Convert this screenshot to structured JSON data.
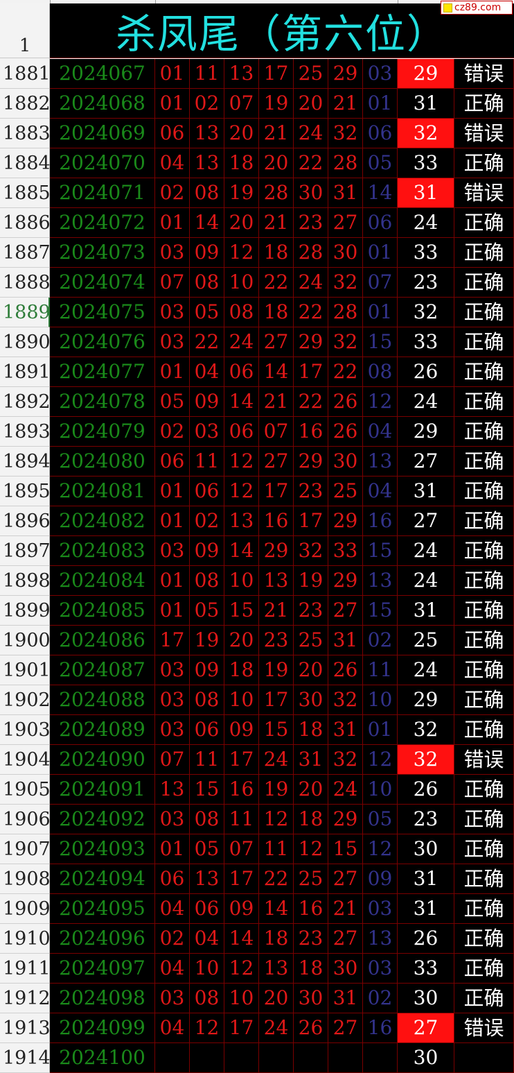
{
  "title": "杀凤尾（第六位）",
  "header_row_number": "1",
  "watermark": "cz89.com",
  "colors": {
    "title": "#22e0e0",
    "period": "#1a8a1a",
    "red_ball": "#e01818",
    "blue_ball": "#33338c",
    "error_fill": "#ff1010",
    "background": "#000000",
    "grid": "#7a0000"
  },
  "active_row": "1889",
  "rows": [
    {
      "rownum": "1881",
      "period": "2024067",
      "balls": [
        "01",
        "11",
        "13",
        "17",
        "25",
        "29"
      ],
      "blue": "03",
      "pred": "29",
      "result": "错误"
    },
    {
      "rownum": "1882",
      "period": "2024068",
      "balls": [
        "01",
        "02",
        "07",
        "19",
        "20",
        "21"
      ],
      "blue": "01",
      "pred": "31",
      "result": "正确"
    },
    {
      "rownum": "1883",
      "period": "2024069",
      "balls": [
        "06",
        "13",
        "20",
        "21",
        "24",
        "32"
      ],
      "blue": "06",
      "pred": "32",
      "result": "错误"
    },
    {
      "rownum": "1884",
      "period": "2024070",
      "balls": [
        "04",
        "13",
        "18",
        "20",
        "22",
        "28"
      ],
      "blue": "05",
      "pred": "33",
      "result": "正确"
    },
    {
      "rownum": "1885",
      "period": "2024071",
      "balls": [
        "02",
        "08",
        "19",
        "28",
        "30",
        "31"
      ],
      "blue": "14",
      "pred": "31",
      "result": "错误"
    },
    {
      "rownum": "1886",
      "period": "2024072",
      "balls": [
        "01",
        "14",
        "20",
        "21",
        "23",
        "27"
      ],
      "blue": "06",
      "pred": "24",
      "result": "正确"
    },
    {
      "rownum": "1887",
      "period": "2024073",
      "balls": [
        "03",
        "09",
        "12",
        "18",
        "28",
        "30"
      ],
      "blue": "01",
      "pred": "33",
      "result": "正确"
    },
    {
      "rownum": "1888",
      "period": "2024074",
      "balls": [
        "07",
        "08",
        "10",
        "22",
        "24",
        "32"
      ],
      "blue": "07",
      "pred": "23",
      "result": "正确"
    },
    {
      "rownum": "1889",
      "period": "2024075",
      "balls": [
        "03",
        "05",
        "08",
        "18",
        "22",
        "28"
      ],
      "blue": "01",
      "pred": "32",
      "result": "正确"
    },
    {
      "rownum": "1890",
      "period": "2024076",
      "balls": [
        "03",
        "22",
        "24",
        "27",
        "29",
        "32"
      ],
      "blue": "15",
      "pred": "33",
      "result": "正确"
    },
    {
      "rownum": "1891",
      "period": "2024077",
      "balls": [
        "01",
        "04",
        "06",
        "14",
        "17",
        "22"
      ],
      "blue": "08",
      "pred": "26",
      "result": "正确"
    },
    {
      "rownum": "1892",
      "period": "2024078",
      "balls": [
        "05",
        "09",
        "14",
        "21",
        "22",
        "26"
      ],
      "blue": "12",
      "pred": "24",
      "result": "正确"
    },
    {
      "rownum": "1893",
      "period": "2024079",
      "balls": [
        "02",
        "03",
        "06",
        "07",
        "16",
        "26"
      ],
      "blue": "04",
      "pred": "29",
      "result": "正确"
    },
    {
      "rownum": "1894",
      "period": "2024080",
      "balls": [
        "06",
        "11",
        "12",
        "27",
        "29",
        "30"
      ],
      "blue": "13",
      "pred": "27",
      "result": "正确"
    },
    {
      "rownum": "1895",
      "period": "2024081",
      "balls": [
        "01",
        "06",
        "12",
        "17",
        "23",
        "25"
      ],
      "blue": "04",
      "pred": "31",
      "result": "正确"
    },
    {
      "rownum": "1896",
      "period": "2024082",
      "balls": [
        "01",
        "02",
        "13",
        "16",
        "17",
        "29"
      ],
      "blue": "16",
      "pred": "27",
      "result": "正确"
    },
    {
      "rownum": "1897",
      "period": "2024083",
      "balls": [
        "03",
        "09",
        "14",
        "29",
        "32",
        "33"
      ],
      "blue": "15",
      "pred": "24",
      "result": "正确"
    },
    {
      "rownum": "1898",
      "period": "2024084",
      "balls": [
        "01",
        "08",
        "10",
        "13",
        "19",
        "29"
      ],
      "blue": "13",
      "pred": "24",
      "result": "正确"
    },
    {
      "rownum": "1899",
      "period": "2024085",
      "balls": [
        "01",
        "05",
        "15",
        "21",
        "23",
        "27"
      ],
      "blue": "15",
      "pred": "31",
      "result": "正确"
    },
    {
      "rownum": "1900",
      "period": "2024086",
      "balls": [
        "17",
        "19",
        "20",
        "23",
        "25",
        "31"
      ],
      "blue": "02",
      "pred": "25",
      "result": "正确"
    },
    {
      "rownum": "1901",
      "period": "2024087",
      "balls": [
        "03",
        "09",
        "18",
        "19",
        "20",
        "26"
      ],
      "blue": "11",
      "pred": "24",
      "result": "正确"
    },
    {
      "rownum": "1902",
      "period": "2024088",
      "balls": [
        "03",
        "08",
        "10",
        "17",
        "30",
        "32"
      ],
      "blue": "10",
      "pred": "29",
      "result": "正确"
    },
    {
      "rownum": "1903",
      "period": "2024089",
      "balls": [
        "03",
        "06",
        "09",
        "15",
        "18",
        "31"
      ],
      "blue": "01",
      "pred": "32",
      "result": "正确"
    },
    {
      "rownum": "1904",
      "period": "2024090",
      "balls": [
        "07",
        "11",
        "17",
        "24",
        "31",
        "32"
      ],
      "blue": "12",
      "pred": "32",
      "result": "错误"
    },
    {
      "rownum": "1905",
      "period": "2024091",
      "balls": [
        "13",
        "15",
        "16",
        "19",
        "20",
        "24"
      ],
      "blue": "10",
      "pred": "26",
      "result": "正确"
    },
    {
      "rownum": "1906",
      "period": "2024092",
      "balls": [
        "03",
        "08",
        "11",
        "12",
        "18",
        "29"
      ],
      "blue": "05",
      "pred": "23",
      "result": "正确"
    },
    {
      "rownum": "1907",
      "period": "2024093",
      "balls": [
        "01",
        "05",
        "07",
        "11",
        "12",
        "15"
      ],
      "blue": "12",
      "pred": "30",
      "result": "正确"
    },
    {
      "rownum": "1908",
      "period": "2024094",
      "balls": [
        "06",
        "13",
        "17",
        "22",
        "25",
        "27"
      ],
      "blue": "09",
      "pred": "31",
      "result": "正确"
    },
    {
      "rownum": "1909",
      "period": "2024095",
      "balls": [
        "04",
        "06",
        "09",
        "14",
        "16",
        "21"
      ],
      "blue": "03",
      "pred": "31",
      "result": "正确"
    },
    {
      "rownum": "1910",
      "period": "2024096",
      "balls": [
        "02",
        "04",
        "14",
        "18",
        "23",
        "27"
      ],
      "blue": "13",
      "pred": "26",
      "result": "正确"
    },
    {
      "rownum": "1911",
      "period": "2024097",
      "balls": [
        "04",
        "10",
        "12",
        "13",
        "18",
        "30"
      ],
      "blue": "03",
      "pred": "33",
      "result": "正确"
    },
    {
      "rownum": "1912",
      "period": "2024098",
      "balls": [
        "03",
        "08",
        "10",
        "20",
        "30",
        "31"
      ],
      "blue": "02",
      "pred": "30",
      "result": "正确"
    },
    {
      "rownum": "1913",
      "period": "2024099",
      "balls": [
        "04",
        "12",
        "17",
        "24",
        "26",
        "27"
      ],
      "blue": "16",
      "pred": "27",
      "result": "错误"
    },
    {
      "rownum": "1914",
      "period": "2024100",
      "balls": [
        "",
        "",
        "",
        "",
        "",
        ""
      ],
      "blue": "",
      "pred": "30",
      "result": ""
    }
  ]
}
